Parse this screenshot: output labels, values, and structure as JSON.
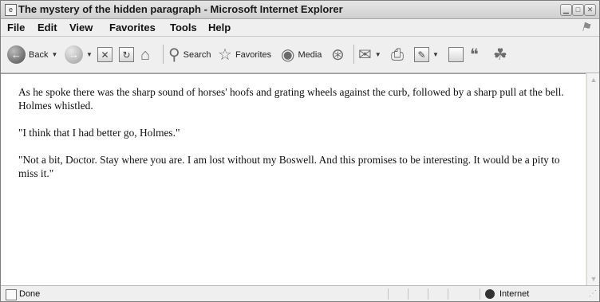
{
  "window": {
    "title": "The mystery of the hidden paragraph - Microsoft Internet Explorer"
  },
  "menu": [
    "File",
    "Edit",
    "View",
    "Favorites",
    "Tools",
    "Help"
  ],
  "toolbar": {
    "back": "Back",
    "search": "Search",
    "favorites": "Favorites",
    "media": "Media"
  },
  "content": {
    "paragraphs": [
      "As he spoke there was the sharp sound of horses' hoofs and grating wheels against the curb, followed by a sharp pull at the bell. Holmes whistled.",
      "\"I think that I had better go, Holmes.\"",
      "\"Not a bit, Doctor. Stay where you are. I am lost without my Boswell. And this promises to be interesting. It would be a pity to miss it.\""
    ]
  },
  "status": {
    "text": "Done",
    "zone": "Internet"
  },
  "icons": {
    "back": "back-arrow-icon",
    "forward": "forward-arrow-icon",
    "stop": "stop-icon",
    "refresh": "refresh-icon",
    "home": "home-icon",
    "search": "search-icon",
    "favorites": "favorites-star-icon",
    "media": "media-icon",
    "history": "history-icon",
    "mail": "mail-icon",
    "print": "printer-icon",
    "edit": "edit-icon",
    "discuss": "discuss-icon",
    "messenger": "messenger-icon",
    "zone": "internet-zone-icon"
  }
}
